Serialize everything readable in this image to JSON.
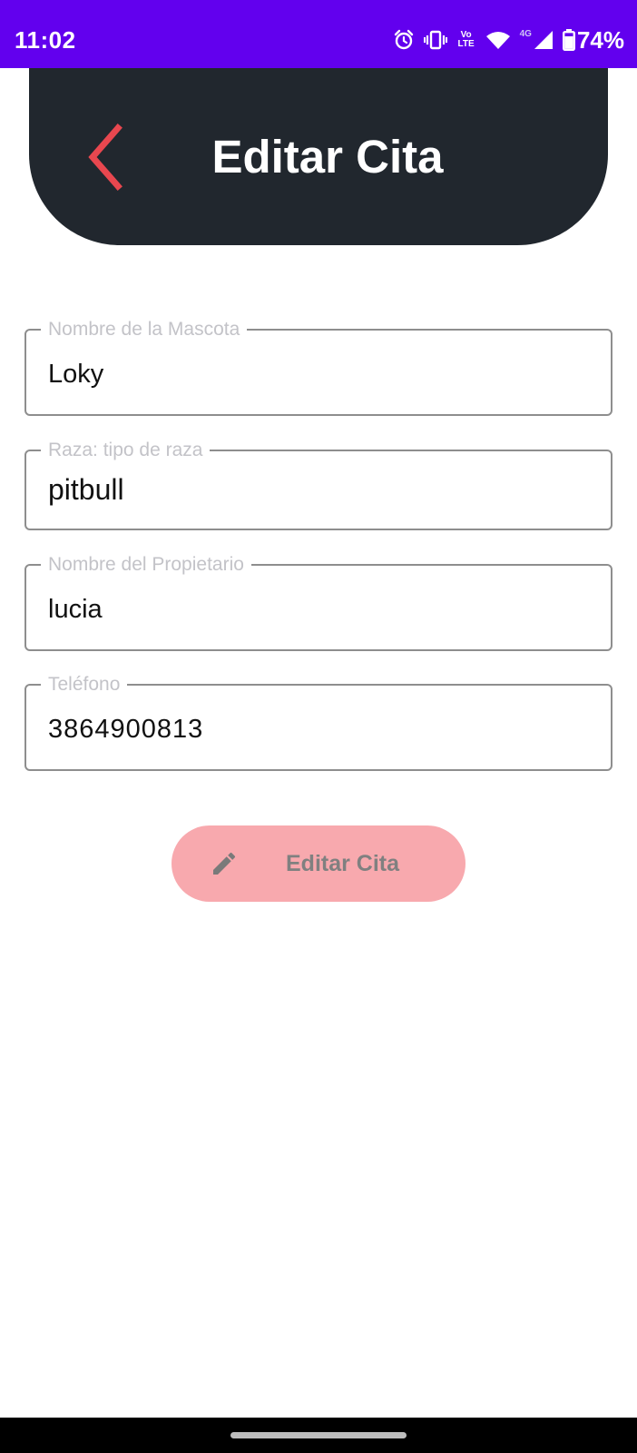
{
  "status_bar": {
    "time": "11:02",
    "battery": "74%",
    "network_label": "4G",
    "volte_label": "Vo LTE",
    "background_color": "#6200ee",
    "icons": [
      "alarm-icon",
      "vibrate-icon",
      "volte-icon",
      "wifi-icon",
      "signal-icon",
      "battery-icon"
    ]
  },
  "header": {
    "title": "Editar Cita",
    "background_color": "#21272e",
    "back_icon_color": "#e8474f"
  },
  "form": {
    "fields": [
      {
        "label": "Nombre de la Mascota",
        "value": "Loky"
      },
      {
        "label": "Raza: tipo de raza",
        "value": "pitbull"
      },
      {
        "label": "Nombre del Propietario",
        "value": "lucia"
      },
      {
        "label": "Teléfono",
        "value": "3864900813"
      }
    ]
  },
  "action": {
    "label": "Editar Cita",
    "icon": "pencil-icon",
    "background_color": "#f8a9ae"
  }
}
